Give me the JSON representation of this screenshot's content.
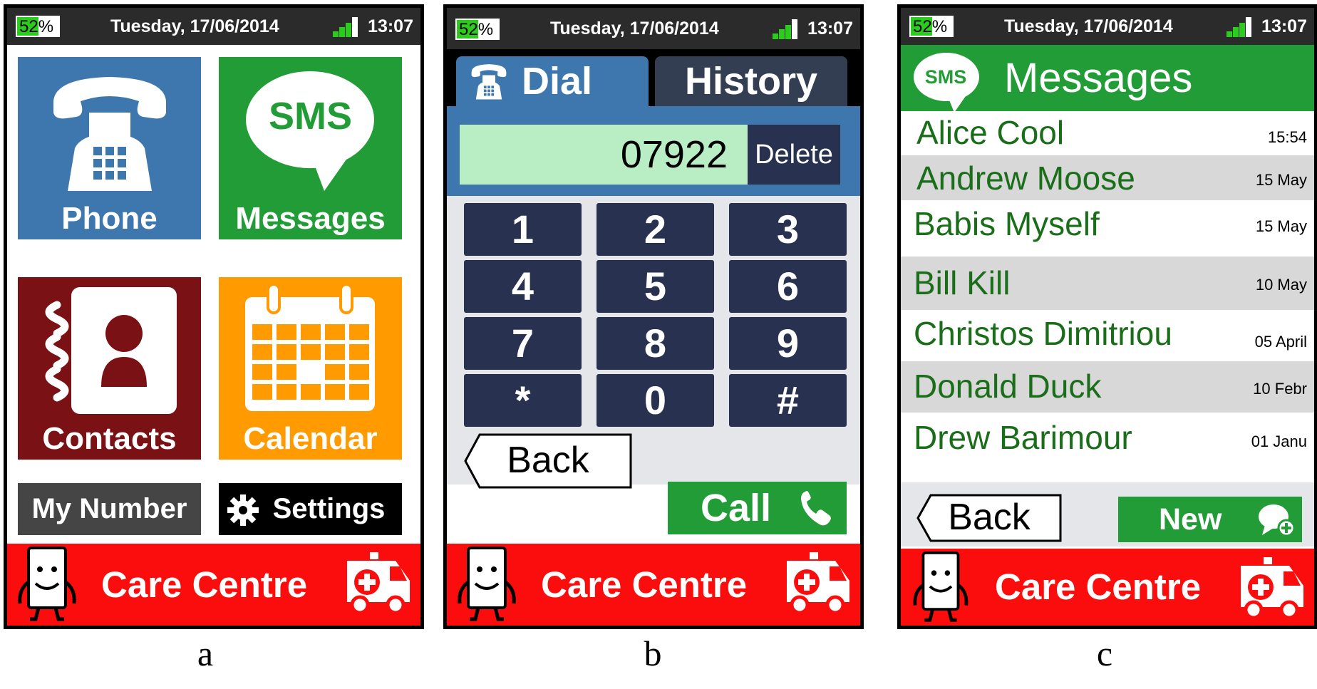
{
  "status_bar": {
    "battery": "52%",
    "battery_level": 0.52,
    "date": "Tuesday, 17/06/2014",
    "time": "13:07"
  },
  "screen_a": {
    "tiles": {
      "phone": "Phone",
      "messages": "Messages",
      "contacts": "Contacts",
      "calendar": "Calendar"
    },
    "sms_icon_text": "SMS",
    "my_number": "My Number",
    "settings": "Settings"
  },
  "care_centre": "Care Centre",
  "screen_b": {
    "tabs": {
      "dial": "Dial",
      "history": "History"
    },
    "dialed_number": "07922",
    "delete": "Delete",
    "keys": [
      "1",
      "2",
      "3",
      "4",
      "5",
      "6",
      "7",
      "8",
      "9",
      "*",
      "0",
      "#"
    ],
    "back": "Back",
    "call": "Call"
  },
  "screen_c": {
    "sms_icon_text": "SMS",
    "title": "Messages",
    "conversations": [
      {
        "name": "Alice Cool",
        "date": "15:54"
      },
      {
        "name": "Andrew Moose",
        "date": "15 May"
      },
      {
        "name": "Babis Myself",
        "date": "15 May"
      },
      {
        "name": "Bill Kill",
        "date": "10 May"
      },
      {
        "name": "Christos Dimitriou",
        "date": "05 April"
      },
      {
        "name": "Donald Duck",
        "date": "10 Febr"
      },
      {
        "name": "Drew Barimour",
        "date": "01 Janu"
      }
    ],
    "back": "Back",
    "new": "New"
  },
  "captions": {
    "a": "a",
    "b": "b",
    "c": "c"
  },
  "colors": {
    "status_bar": "#2b2b2b",
    "phone_tile": "#3d77ad",
    "messages_tile": "#229c36",
    "contacts_tile": "#7a1215",
    "calendar_tile": "#ff9a00",
    "care_bar": "#fc0d0d",
    "keypad_key": "#28314f",
    "number_field": "#b9eec5",
    "message_name": "#1a6e1a"
  },
  "icons": [
    "telephone-icon",
    "sms-bubble-icon",
    "address-book-icon",
    "calendar-icon",
    "gear-icon",
    "robot-phone-icon",
    "ambulance-icon",
    "handset-icon",
    "new-message-icon"
  ]
}
